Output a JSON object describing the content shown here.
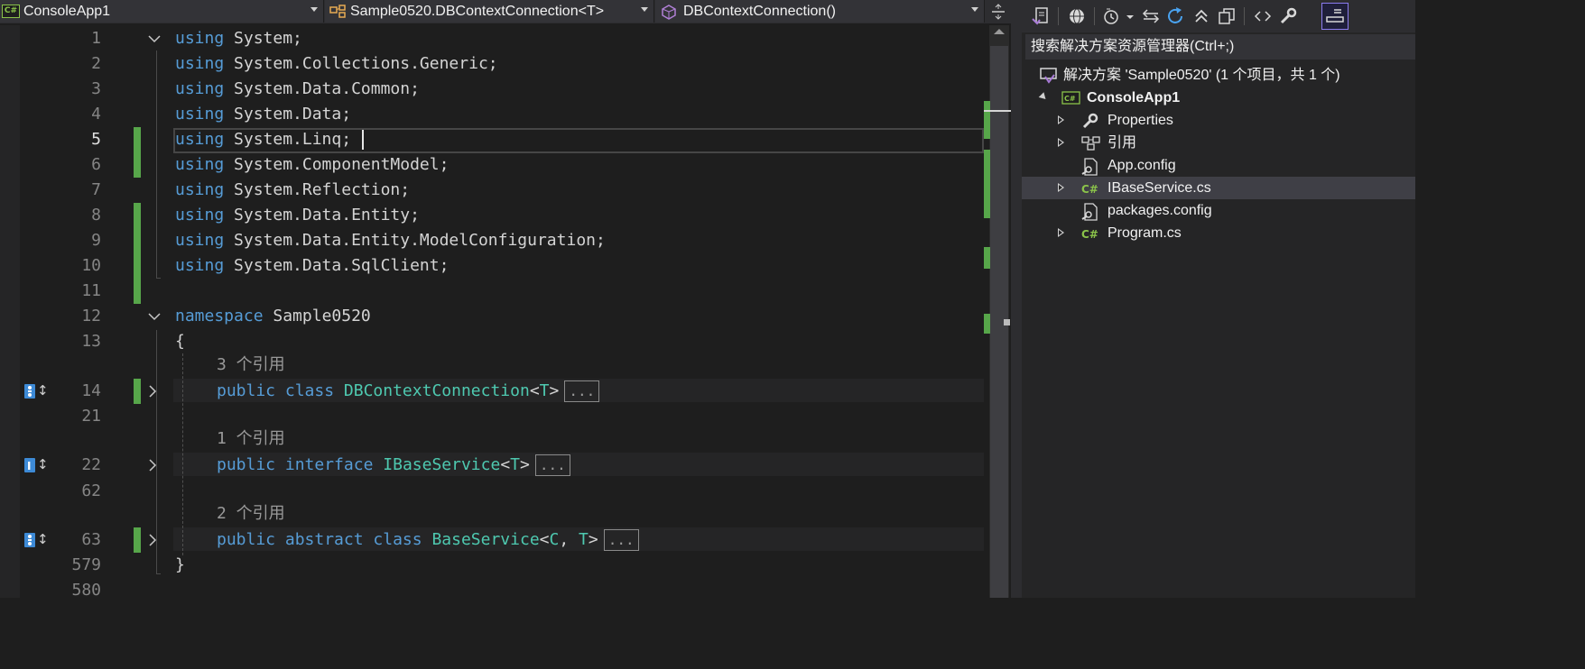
{
  "nav": {
    "project": "ConsoleApp1",
    "type": "Sample0520.DBContextConnection<T>",
    "member": "DBContextConnection()"
  },
  "editor": {
    "current_line": 5,
    "lines": [
      {
        "n": "1",
        "code": [
          {
            "k": "kw",
            "t": "using"
          },
          {
            "k": "",
            "t": " System;"
          }
        ]
      },
      {
        "n": "2",
        "code": [
          {
            "k": "kw",
            "t": "using"
          },
          {
            "k": "",
            "t": " System.Collections.Generic;"
          }
        ]
      },
      {
        "n": "3",
        "code": [
          {
            "k": "kw",
            "t": "using"
          },
          {
            "k": "",
            "t": " System.Data.Common;"
          }
        ]
      },
      {
        "n": "4",
        "code": [
          {
            "k": "kw",
            "t": "using"
          },
          {
            "k": "",
            "t": " System.Data;"
          }
        ]
      },
      {
        "n": "5",
        "code": [
          {
            "k": "kw",
            "t": "using"
          },
          {
            "k": "",
            "t": " System.Linq;"
          }
        ]
      },
      {
        "n": "6",
        "code": [
          {
            "k": "kw",
            "t": "using"
          },
          {
            "k": "",
            "t": " System.ComponentModel;"
          }
        ]
      },
      {
        "n": "7",
        "code": [
          {
            "k": "kw",
            "t": "using"
          },
          {
            "k": "",
            "t": " System.Reflection;"
          }
        ]
      },
      {
        "n": "8",
        "code": [
          {
            "k": "kw",
            "t": "using"
          },
          {
            "k": "",
            "t": " System.Data.Entity;"
          }
        ]
      },
      {
        "n": "9",
        "code": [
          {
            "k": "kw",
            "t": "using"
          },
          {
            "k": "",
            "t": " System.Data.Entity.ModelConfiguration;"
          }
        ]
      },
      {
        "n": "10",
        "code": [
          {
            "k": "kw",
            "t": "using"
          },
          {
            "k": "",
            "t": " System.Data.SqlClient;"
          }
        ]
      },
      {
        "n": "11",
        "code": []
      },
      {
        "n": "12",
        "code": [
          {
            "k": "kw",
            "t": "namespace"
          },
          {
            "k": "",
            "t": " Sample0520"
          }
        ]
      },
      {
        "n": "13",
        "code": [
          {
            "k": "",
            "t": "{"
          }
        ]
      },
      {
        "n": "14",
        "lens": "3 个引用",
        "code": [
          {
            "k": "kw",
            "t": "public"
          },
          {
            "k": "",
            "t": " "
          },
          {
            "k": "kw",
            "t": "class"
          },
          {
            "k": "",
            "t": " "
          },
          {
            "k": "ty",
            "t": "DBContextConnection"
          },
          {
            "k": "",
            "t": "<"
          },
          {
            "k": "ty",
            "t": "T"
          },
          {
            "k": "",
            "t": ">"
          }
        ],
        "collapsed": "..."
      },
      {
        "n": "21",
        "code": []
      },
      {
        "n": "22",
        "lens": "1 个引用",
        "code": [
          {
            "k": "kw",
            "t": "public"
          },
          {
            "k": "",
            "t": " "
          },
          {
            "k": "kw",
            "t": "interface"
          },
          {
            "k": "",
            "t": " "
          },
          {
            "k": "ty",
            "t": "IBaseService"
          },
          {
            "k": "",
            "t": "<"
          },
          {
            "k": "ty",
            "t": "T"
          },
          {
            "k": "",
            "t": ">"
          }
        ],
        "collapsed": "..."
      },
      {
        "n": "62",
        "code": []
      },
      {
        "n": "63",
        "lens": "2 个引用",
        "code": [
          {
            "k": "kw",
            "t": "public"
          },
          {
            "k": "",
            "t": " "
          },
          {
            "k": "kw",
            "t": "abstract"
          },
          {
            "k": "",
            "t": " "
          },
          {
            "k": "kw",
            "t": "class"
          },
          {
            "k": "",
            "t": " "
          },
          {
            "k": "ty",
            "t": "BaseService"
          },
          {
            "k": "",
            "t": "<"
          },
          {
            "k": "ty",
            "t": "C"
          },
          {
            "k": "",
            "t": ", "
          },
          {
            "k": "ty",
            "t": "T"
          },
          {
            "k": "",
            "t": ">"
          }
        ],
        "collapsed": "..."
      },
      {
        "n": "579",
        "code": [
          {
            "k": "",
            "t": "}"
          }
        ]
      },
      {
        "n": "580",
        "code": []
      }
    ]
  },
  "solution_explorer": {
    "search_placeholder": "搜索解决方案资源管理器(Ctrl+;)",
    "solution_label": "解决方案 'Sample0520' (1 个项目，共 1 个)",
    "items": [
      {
        "label": "ConsoleApp1",
        "icon": "csharp-project-icon"
      },
      {
        "label": "Properties",
        "icon": "wrench-icon"
      },
      {
        "label": "引用",
        "icon": "references-icon"
      },
      {
        "label": "App.config",
        "icon": "config-file-icon"
      },
      {
        "label": "IBaseService.cs",
        "icon": "csharp-file-icon"
      },
      {
        "label": "packages.config",
        "icon": "config-file-icon"
      },
      {
        "label": "Program.cs",
        "icon": "csharp-file-icon"
      }
    ]
  },
  "colors": {
    "keyword": "#569cd6",
    "type": "#4ec9b0",
    "change_bar": "#57a64a",
    "background": "#1e1e1e"
  }
}
